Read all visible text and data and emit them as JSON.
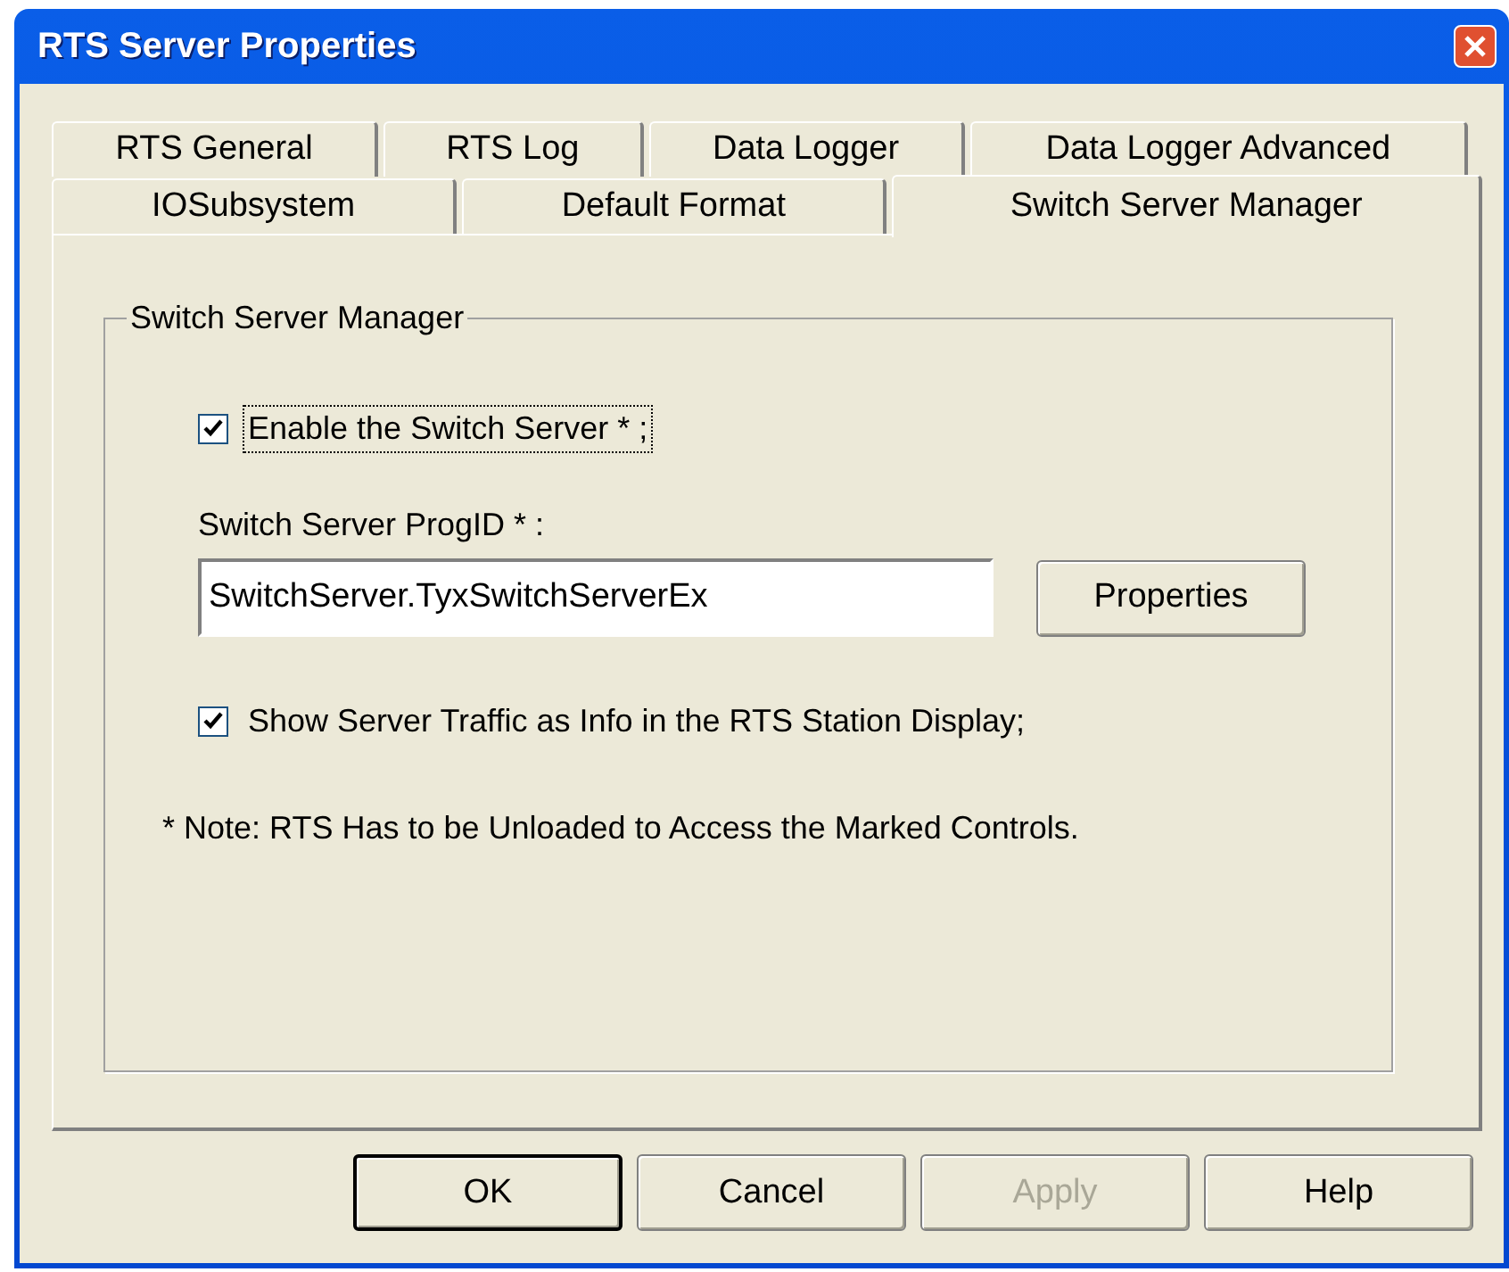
{
  "window": {
    "title": "RTS Server Properties"
  },
  "tab_rows": [
    {
      "tabs": [
        {
          "label": "RTS General",
          "selected": false
        },
        {
          "label": "RTS Log",
          "selected": false
        },
        {
          "label": "Data Logger",
          "selected": false
        },
        {
          "label": "Data Logger Advanced",
          "selected": false
        }
      ]
    },
    {
      "tabs": [
        {
          "label": "IOSubsystem",
          "selected": false
        },
        {
          "label": "Default Format",
          "selected": false
        },
        {
          "label": "Switch Server Manager",
          "selected": true
        }
      ]
    }
  ],
  "group": {
    "title": "Switch Server Manager",
    "enable_checkbox": {
      "label": "Enable the Switch Server * ;",
      "checked": true,
      "focused": true
    },
    "progid_label": "Switch Server ProgID * :",
    "progid_field": {
      "value": "SwitchServer.TyxSwitchServerEx"
    },
    "properties_button": "Properties",
    "traffic_checkbox": {
      "label": "Show Server Traffic as Info in the RTS Station Display;",
      "checked": true,
      "focused": false
    },
    "note": "* Note: RTS Has to be Unloaded to Access the Marked Controls."
  },
  "buttons": [
    {
      "label": "OK",
      "default": true,
      "disabled": false
    },
    {
      "label": "Cancel",
      "default": false,
      "disabled": false
    },
    {
      "label": "Apply",
      "default": false,
      "disabled": true
    },
    {
      "label": "Help",
      "default": false,
      "disabled": false
    }
  ]
}
